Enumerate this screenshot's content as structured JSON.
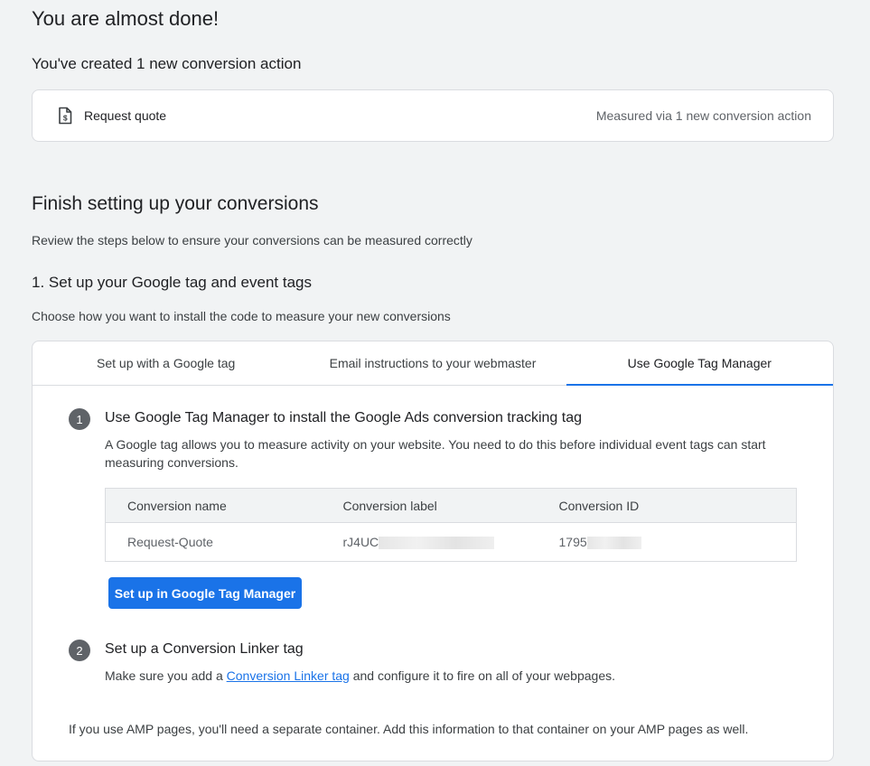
{
  "header": {
    "title": "You are almost done!",
    "created_text": "You've created 1 new conversion action"
  },
  "summary": {
    "icon": "receipt-icon",
    "action_name": "Request quote",
    "measured_text": "Measured via 1 new conversion action"
  },
  "finish": {
    "title": "Finish setting up your conversions",
    "description": "Review the steps below to ensure your conversions can be measured correctly",
    "step1_title": "1. Set up your Google tag and event tags",
    "choose_text": "Choose how you want to install the code to measure your new conversions"
  },
  "tabs": [
    {
      "label": "Set up with a Google tag",
      "active": false
    },
    {
      "label": "Email instructions to your webmaster",
      "active": false
    },
    {
      "label": "Use Google Tag Manager",
      "active": true
    }
  ],
  "gtm": {
    "step1": {
      "number": "1",
      "title": "Use Google Tag Manager to install the Google Ads conversion tracking tag",
      "description": "A Google tag allows you to measure activity on your website. You need to do this before individual event tags can start measuring conversions."
    },
    "table": {
      "headers": [
        "Conversion name",
        "Conversion label",
        "Conversion ID"
      ],
      "rows": [
        {
          "name": "Request-Quote",
          "label": "rJ4UC",
          "id": "1795"
        }
      ]
    },
    "button_label": "Set up in Google Tag Manager",
    "step2": {
      "number": "2",
      "title": "Set up a Conversion Linker tag",
      "desc_before": "Make sure you add a ",
      "link_text": "Conversion Linker tag",
      "desc_after": " and configure it to fire on all of your webpages."
    },
    "amp_note": "If you use AMP pages, you'll need a separate container. Add this information to that container on your AMP pages as well."
  },
  "colors": {
    "accent": "#1a73e8",
    "background": "#f1f3f4",
    "step_badge": "#5f6368"
  }
}
